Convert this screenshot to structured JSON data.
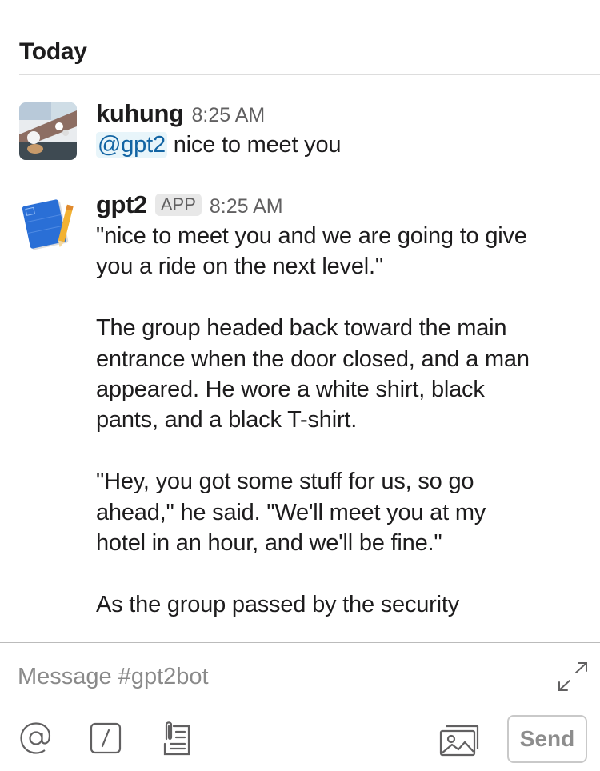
{
  "day_divider": {
    "label": "Today"
  },
  "messages": [
    {
      "sender": "kuhung",
      "time": "8:25 AM",
      "mention": "@gpt2",
      "text": " nice to meet you"
    },
    {
      "sender": "gpt2",
      "badge": "APP",
      "time": "8:25 AM",
      "paragraphs": [
        "\"nice to meet you and we are going to give\nyou a ride on the next level.\"",
        "The group headed back toward the main\nentrance when the door closed, and a man\nappeared. He wore a white shirt, black\npants, and a black T-shirt.",
        "\"Hey, you got some stuff for us, so go\nahead,\" he said. \"We'll meet you at my\nhotel in an hour, and we'll be fine.\"",
        "As the group passed by the security"
      ]
    }
  ],
  "composer": {
    "placeholder": "Message #gpt2bot",
    "send_label": "Send",
    "icons": [
      "expand-icon",
      "at-mention-icon",
      "slash-command-icon",
      "attachment-icon",
      "photo-icon"
    ]
  }
}
